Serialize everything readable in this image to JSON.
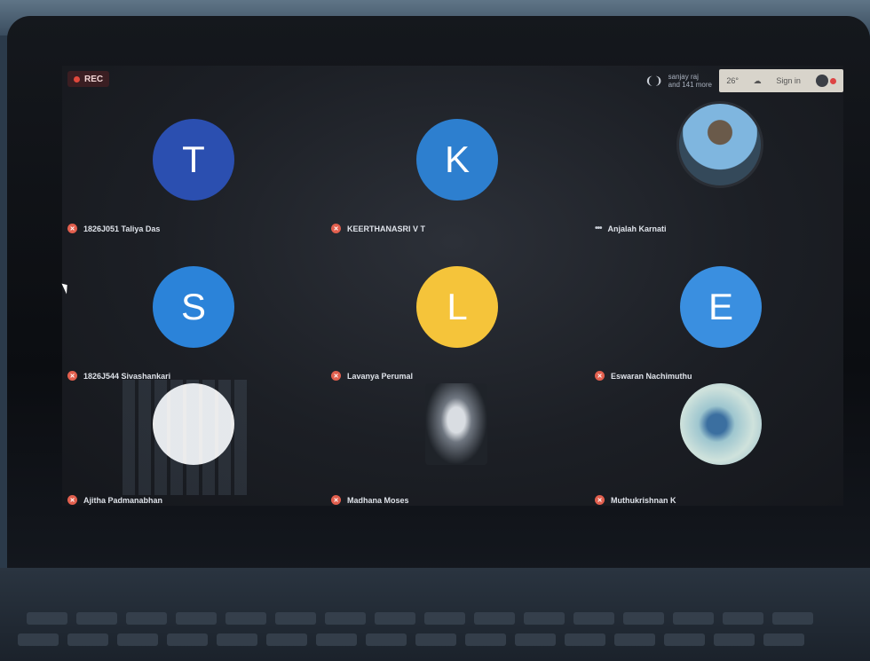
{
  "recording": {
    "label": "REC"
  },
  "participants_info": {
    "line1": "sanjay raj",
    "line2": "and 141 more"
  },
  "tray": {
    "temperature": "26°",
    "icon_name": "weather-icon",
    "sign_in": "Sign in"
  },
  "tiles": [
    {
      "initial": "T",
      "name": "1826J051 Taliya Das",
      "color": "#2b4fb0",
      "status": "muted"
    },
    {
      "initial": "K",
      "name": "KEERTHANASRI V T",
      "color": "#2d7fcf",
      "status": "muted"
    },
    {
      "initial": "",
      "name": "Anjalah Karnati",
      "color": "#5a8fbd",
      "status": "speaking",
      "photo": true
    },
    {
      "initial": "S",
      "name": "1826J544 Sivashankari",
      "color": "#2b83d9",
      "status": "muted"
    },
    {
      "initial": "L",
      "name": "Lavanya Perumal",
      "color": "#f5c43a",
      "status": "muted"
    },
    {
      "initial": "E",
      "name": "Eswaran Nachimuthu",
      "color": "#3a8fe0",
      "status": "muted"
    },
    {
      "initial": "",
      "name": "Ajitha Padmanabhan",
      "color": "#f4f4f4",
      "status": "muted"
    },
    {
      "initial": "",
      "name": "Madhana Moses",
      "color": "transparent",
      "status": "muted",
      "photo": true
    },
    {
      "initial": "",
      "name": "Muthukrishnan K",
      "color": "#8fb9c8",
      "status": "muted",
      "photo": true
    }
  ],
  "colors": {
    "muted_badge": "#e25f4e",
    "rec_dot": "#e0483c",
    "screen_bg": "#1c1f25"
  }
}
